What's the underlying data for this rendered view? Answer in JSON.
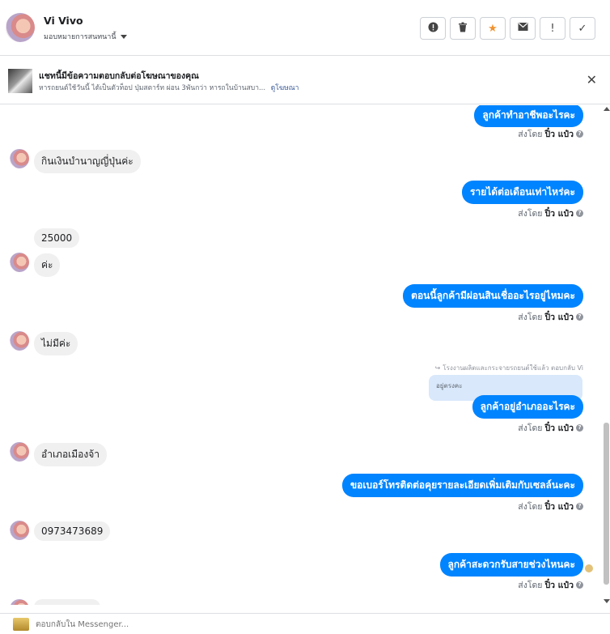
{
  "header": {
    "name": "Vi Vivo",
    "assign_label": "มอบหมายการสนทนานี้",
    "actions": [
      "report-icon",
      "trash-icon",
      "star-icon",
      "mark-unread-icon",
      "spam-icon",
      "done-icon"
    ]
  },
  "ad": {
    "title": "แชทนี้มีข้อความตอบกลับต่อโฆษณาของคุณ",
    "subtitle": "หารถยนต์ใช้วันนี้ ได้เป็นตัวท็อป ปุ่มสตาร์ท ผ่อน 3พันกว่า หารถในบ้านสบา...",
    "link": "ดูโฆษณา"
  },
  "thread": {
    "sent_prefix": "ส่งโดย",
    "sender": "ปิ๋ว แป๋ว",
    "messages": [
      {
        "dir": "out",
        "text": "ลูกค้าทำอาชีพอะไรคะ"
      },
      {
        "dir": "in",
        "text": "กินเงินบำนาญญี่ปุ่นค่ะ"
      },
      {
        "dir": "out",
        "text": "รายได้ต่อเดือนเท่าไหร่คะ"
      },
      {
        "dir": "in",
        "text": "25000"
      },
      {
        "dir": "in",
        "text": "ค่ะ"
      },
      {
        "dir": "out",
        "text": "ตอนนี้ลูกค้ามีผ่อนสินเชื่ออะไรอยู่ไหมคะ"
      },
      {
        "dir": "in",
        "text": "ไม่มีค่ะ"
      },
      {
        "dir": "out",
        "text": "ลูกค้าอยู่อำเภออะไรคะ"
      },
      {
        "dir": "in",
        "text": "อำเภอเมืองจ้า"
      },
      {
        "dir": "out",
        "text": "ขอเบอร์โทรติดต่อคุยรายละเอียดเพิ่มเติมกับเซลล์นะคะ"
      },
      {
        "dir": "in",
        "text": "0973473689"
      },
      {
        "dir": "out",
        "text": "ลูกค้าสะดวกรับสายช่วงไหนคะ"
      }
    ],
    "reply_meta": "โรงงานผลิตและกระจายรถยนต์ใช้แล้ว ตอบกลับ Vi",
    "reply_quote": "อยู่ตรงคะ"
  },
  "composer": {
    "placeholder": "ตอบกลับใน Messenger..."
  },
  "colors": {
    "bubble_out": "#0084ff",
    "bubble_in": "#f1f0f0",
    "star": "#f0922f"
  }
}
